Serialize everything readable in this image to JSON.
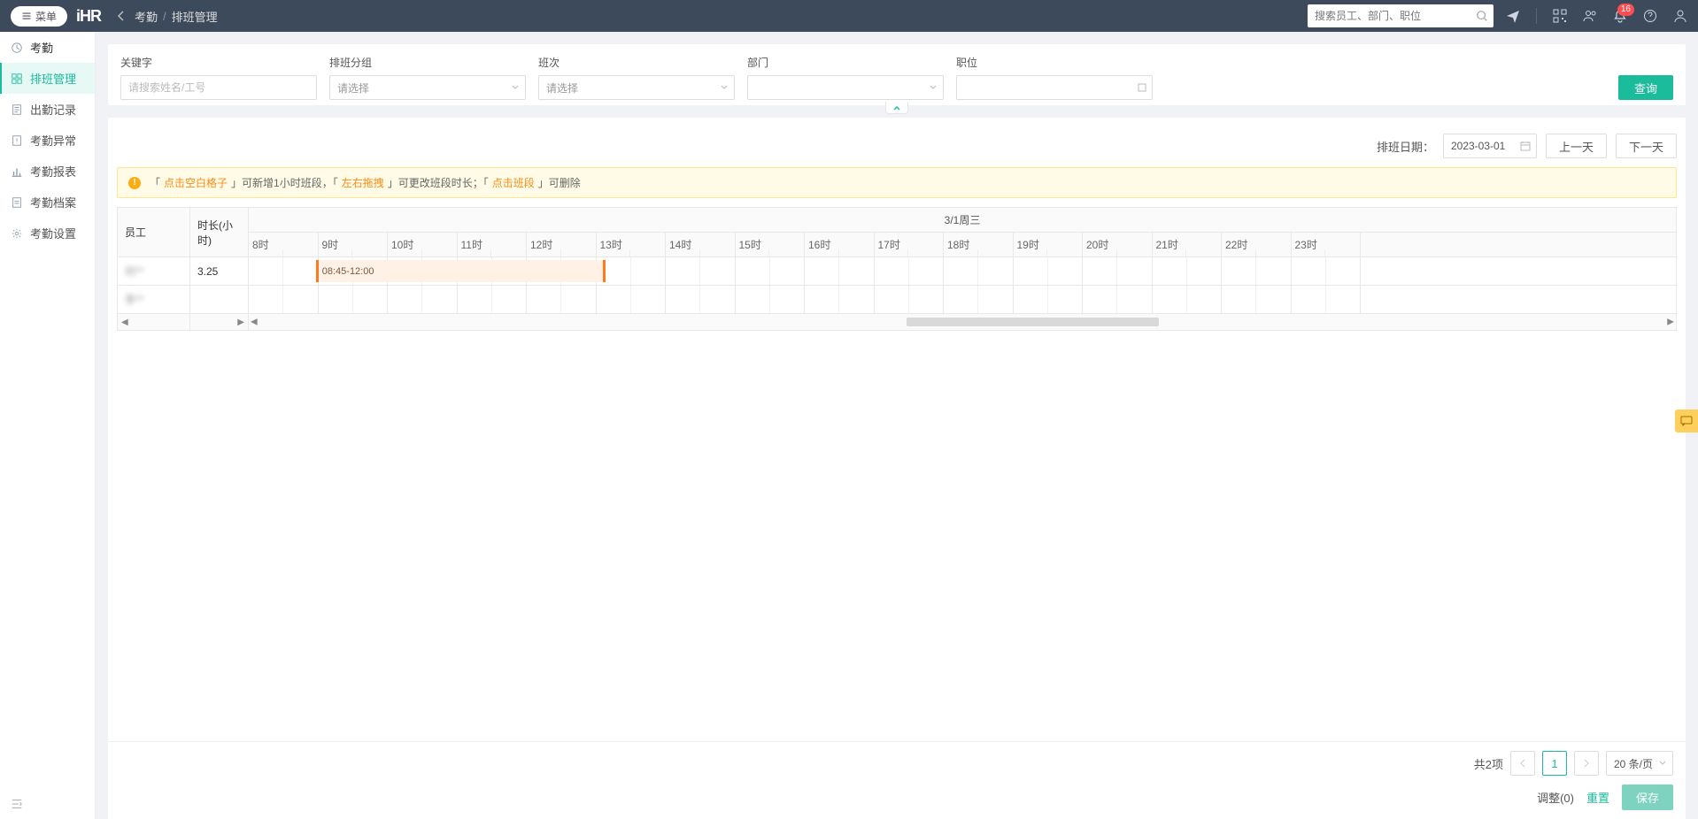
{
  "header": {
    "menu_label": "菜单",
    "logo": "iHR",
    "breadcrumb": {
      "module": "考勤",
      "page": "排班管理"
    },
    "search_placeholder": "搜索员工、部门、职位",
    "notif_count": "16"
  },
  "sidebar": {
    "items": [
      {
        "icon": "clock",
        "label": "考勤",
        "group": true,
        "active": false
      },
      {
        "icon": "grid",
        "label": "排班管理",
        "group": false,
        "active": true
      },
      {
        "icon": "doc",
        "label": "出勤记录",
        "group": false,
        "active": false
      },
      {
        "icon": "warn",
        "label": "考勤异常",
        "group": false,
        "active": false
      },
      {
        "icon": "chart",
        "label": "考勤报表",
        "group": false,
        "active": false
      },
      {
        "icon": "file",
        "label": "考勤档案",
        "group": false,
        "active": false
      },
      {
        "icon": "gear",
        "label": "考勤设置",
        "group": false,
        "active": false
      }
    ]
  },
  "filters": {
    "keyword": {
      "label": "关键字",
      "placeholder": "请搜索姓名/工号"
    },
    "group": {
      "label": "排班分组",
      "placeholder": "请选择"
    },
    "shift": {
      "label": "班次",
      "placeholder": "请选择"
    },
    "dept": {
      "label": "部门",
      "placeholder": ""
    },
    "job": {
      "label": "职位",
      "placeholder": ""
    },
    "query_btn": "查询"
  },
  "date_row": {
    "label": "排班日期：",
    "date": "2023-03-01",
    "prev": "上一天",
    "next": "下一天"
  },
  "tip": {
    "p1": "「",
    "h1": "点击空白格子",
    "p2": "」可新增1小时班段，「",
    "h2": "左右拖拽",
    "p3": "」可更改班段时长；「",
    "h3": "点击班段",
    "p4": "」可删除"
  },
  "schedule": {
    "col_emp": "员工",
    "col_dur": "时长(小时)",
    "day_header": "3/1周三",
    "hours": [
      "8时",
      "9时",
      "10时",
      "11时",
      "12时",
      "13时",
      "14时",
      "15时",
      "16时",
      "17时",
      "18时",
      "19时",
      "20时",
      "21时",
      "22时",
      "23时"
    ],
    "rows": [
      {
        "emp": "何**",
        "dur": "3.25",
        "shifts": [
          {
            "label": "08:45-12:00",
            "start_pct": 4.7,
            "width_pct": 20.3
          }
        ]
      },
      {
        "emp": "李**",
        "dur": "",
        "shifts": []
      }
    ]
  },
  "pagination": {
    "total_text": "共2项",
    "page": "1",
    "size_label": "20 条/页"
  },
  "actions": {
    "adjust": "调整(0)",
    "reset": "重置",
    "save": "保存"
  }
}
